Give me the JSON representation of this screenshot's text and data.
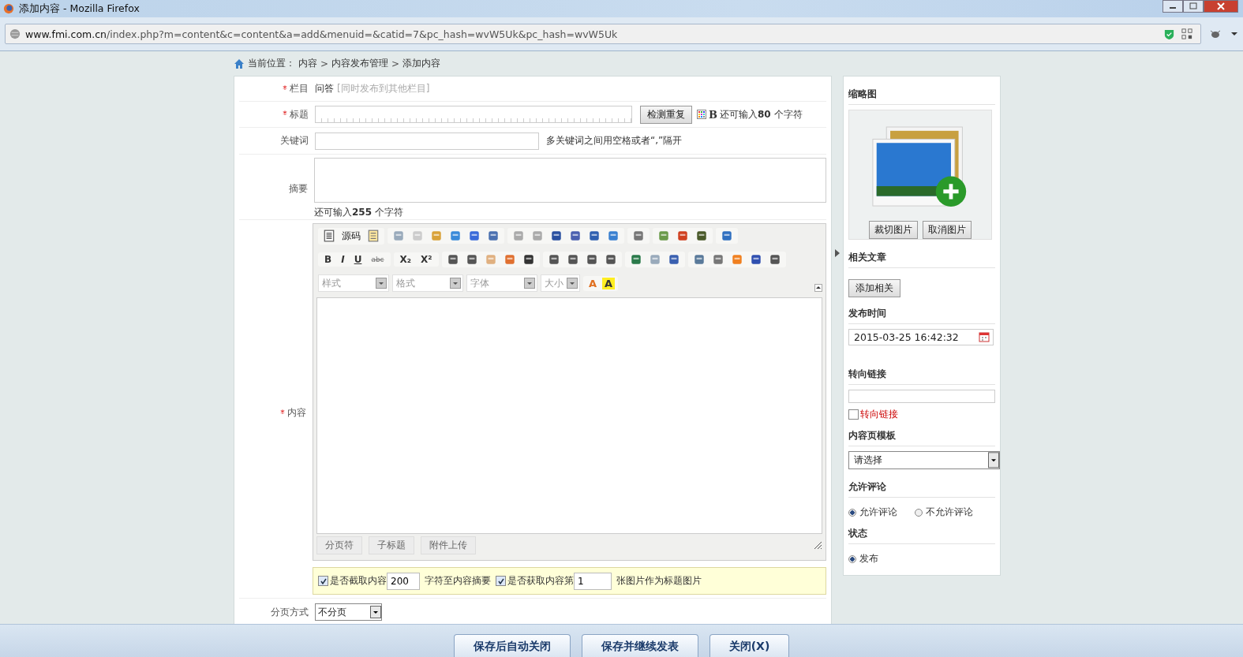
{
  "window": {
    "title": "添加内容 - Mozilla Firefox"
  },
  "address_bar": {
    "host": "www.fmi.com.cn",
    "path": "/index.php?m=content&c=content&a=add&menuid=&catid=7&pc_hash=wvW5Uk&pc_hash=wvW5Uk"
  },
  "breadcrumb": {
    "label": "当前位置：",
    "separator": ">",
    "items": [
      "内容",
      "内容发布管理",
      "添加内容"
    ]
  },
  "form": {
    "category": {
      "label": "栏目",
      "required": true,
      "value": "问答",
      "hint": "[同时发布到其他栏目]"
    },
    "title": {
      "label": "标题",
      "required": true,
      "check_button": "检测重复",
      "bold_button": "B",
      "remaining": "还可输入**80** 个字符"
    },
    "keywords": {
      "label": "关键词",
      "required": false,
      "hint": "多关键词之间用空格或者“,”隔开"
    },
    "summary": {
      "label": "摘要",
      "required": false,
      "remaining": "还可输入**255** 个字符"
    },
    "content": {
      "label": "内容",
      "required": true,
      "editor": {
        "source_label": "源码",
        "format_buttons": [
          "B",
          "I",
          "U",
          "abc",
          "X₂",
          "X²"
        ],
        "dropdowns": [
          {
            "label": "样式"
          },
          {
            "label": "格式"
          },
          {
            "label": "字体"
          },
          {
            "label": "大小"
          }
        ],
        "color_buttons": [
          "A",
          "A"
        ],
        "bottom_buttons": [
          "分页符",
          "子标题",
          "附件上传"
        ]
      },
      "options": {
        "truncate_checked": true,
        "truncate_label": "是否截取内容",
        "truncate_value": "200",
        "truncate_suffix": "字符至内容摘要",
        "fetch_checked": true,
        "fetch_label": "是否获取内容第",
        "fetch_value": "1",
        "fetch_suffix": "张图片作为标题图片"
      }
    },
    "pagination": {
      "label": "分页方式",
      "required": false,
      "value": "不分页"
    }
  },
  "sidebar": {
    "thumbnail": {
      "heading": "缩略图",
      "buttons": [
        "裁切图片",
        "取消图片"
      ]
    },
    "related": {
      "heading": "相关文章",
      "button": "添加相关"
    },
    "publish_time": {
      "heading": "发布时间",
      "value": "2015-03-25 16:42:32"
    },
    "redirect": {
      "heading": "转向链接",
      "checkbox_label": "转向链接",
      "checked": false
    },
    "template": {
      "heading": "内容页模板",
      "value": "请选择"
    },
    "comments": {
      "heading": "允许评论",
      "options": [
        {
          "label": "允许评论",
          "selected": true
        },
        {
          "label": "不允许评论",
          "selected": false
        }
      ]
    },
    "status": {
      "heading": "状态",
      "options": [
        {
          "label": "发布",
          "selected": true
        }
      ]
    }
  },
  "footer_buttons": [
    "保存后自动关闭",
    "保存并继续发表",
    "关闭(X)"
  ]
}
